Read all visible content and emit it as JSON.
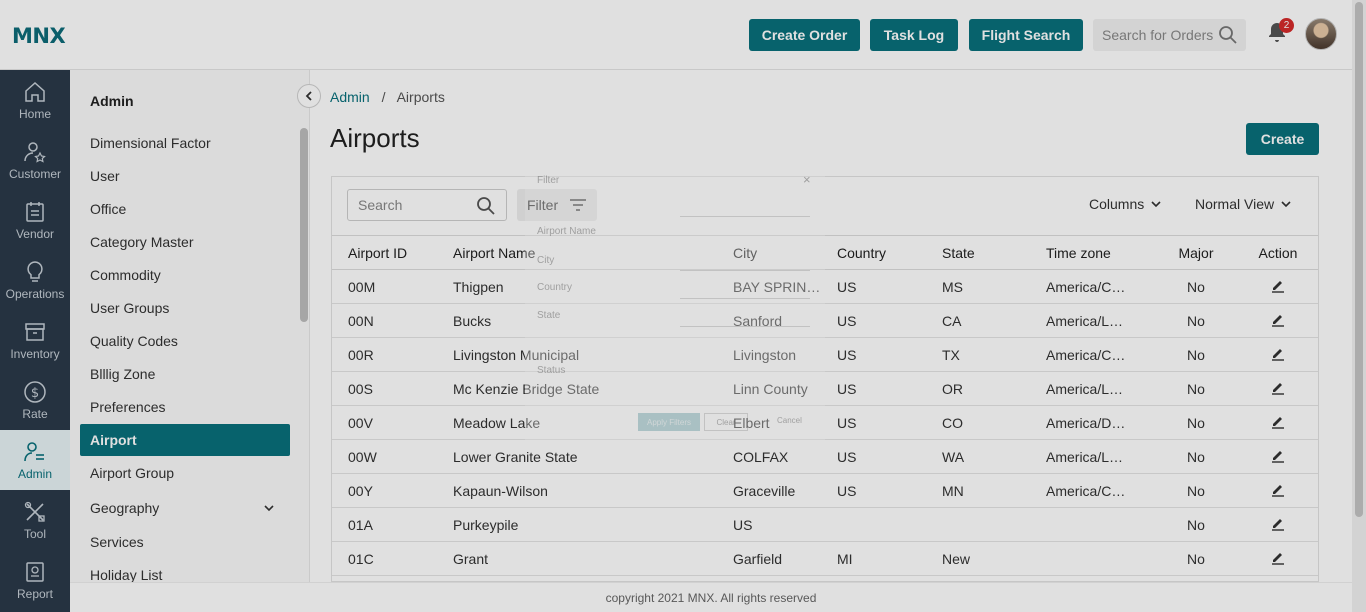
{
  "brand": {
    "logo": "MNX",
    "accent": "#08707c"
  },
  "header": {
    "buttons": [
      "Create Order",
      "Task Log",
      "Flight Search"
    ],
    "search_placeholder": "Search for Orders",
    "notification_count": "2"
  },
  "rail": [
    {
      "label": "Home",
      "icon": "home-icon"
    },
    {
      "label": "Customer",
      "icon": "customer-icon"
    },
    {
      "label": "Vendor",
      "icon": "vendor-icon"
    },
    {
      "label": "Operations",
      "icon": "bulb-icon"
    },
    {
      "label": "Inventory",
      "icon": "box-icon"
    },
    {
      "label": "Rate",
      "icon": "dollar-icon"
    },
    {
      "label": "Admin",
      "icon": "admin-icon",
      "active": true
    },
    {
      "label": "Tool",
      "icon": "tools-icon"
    },
    {
      "label": "Report",
      "icon": "report-icon"
    }
  ],
  "subnav": {
    "title": "Admin",
    "items": [
      "Dimensional Factor",
      "User",
      "Office",
      "Category Master",
      "Commodity",
      "User Groups",
      "Quality Codes",
      "Blllig Zone",
      "Preferences",
      "Airport",
      "Airport Group",
      "Geography",
      "Services",
      "Holiday List"
    ],
    "active": "Airport"
  },
  "breadcrumb": {
    "root": "Admin",
    "separator": "/",
    "current": "Airports"
  },
  "page": {
    "title": "Airports",
    "create_label": "Create"
  },
  "toolbar": {
    "search_placeholder": "Search",
    "filter_label": "Filter",
    "columns_label": "Columns",
    "view_label": "Normal View"
  },
  "table": {
    "columns": [
      "Airport ID",
      "Airport Name",
      "City",
      "Country",
      "State",
      "Time zone",
      "Major",
      "Action"
    ],
    "rows": [
      [
        "00M",
        "Thigpen",
        "BAY SPRIN…",
        "US",
        "MS",
        "America/C…",
        "No"
      ],
      [
        "00N",
        "Bucks",
        "Sanford",
        "US",
        "CA",
        "America/L…",
        "No"
      ],
      [
        "00R",
        "Livingston Municipal",
        "Livingston",
        "US",
        "TX",
        "America/C…",
        "No"
      ],
      [
        "00S",
        "Mc Kenzie Bridge State",
        "Linn County",
        "US",
        "OR",
        "America/L…",
        "No"
      ],
      [
        "00V",
        "Meadow Lake",
        "Elbert",
        "US",
        "CO",
        "America/D…",
        "No"
      ],
      [
        "00W",
        "Lower Granite State",
        "COLFAX",
        "US",
        "WA",
        "America/L…",
        "No"
      ],
      [
        "00Y",
        "Kapaun-Wilson",
        "Graceville",
        "US",
        "MN",
        "America/C…",
        "No"
      ],
      [
        "01A",
        "Purkeypile",
        "US",
        "",
        "",
        "",
        "No"
      ],
      [
        "01C",
        "Grant",
        "Garfield",
        "MI",
        "New",
        "",
        "No"
      ]
    ]
  },
  "filter_modal": {
    "title": "Filter",
    "labels": [
      "Airport Name",
      "City",
      "Country",
      "State",
      "Status"
    ],
    "apply_label": "Apply Filters",
    "clear_label": "Clear",
    "cancel_label": "Cancel"
  },
  "footer": {
    "text": "copyright 2021 MNX. All rights reserved"
  }
}
